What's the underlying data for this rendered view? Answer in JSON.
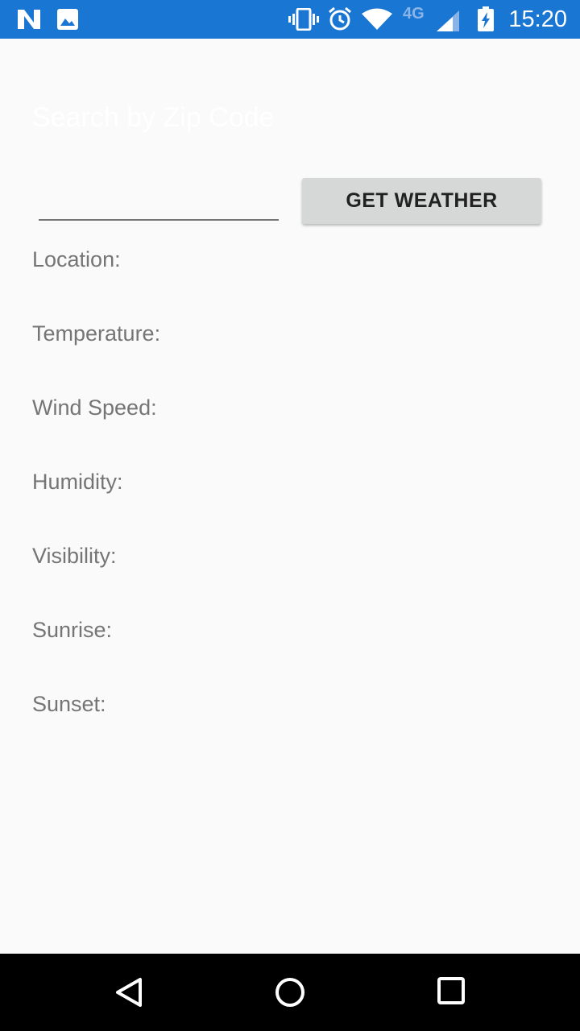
{
  "status_bar": {
    "time": "15:20",
    "network_type": "4G",
    "icons": [
      "app-n-icon",
      "gallery-icon",
      "vibrate-icon",
      "alarm-icon",
      "wifi-icon",
      "cell-signal-icon",
      "battery-charging-icon"
    ]
  },
  "colors": {
    "status_bar": "#1976d2",
    "background": "#fafafa",
    "button": "#d6d7d7",
    "label_text": "#757575"
  },
  "header": {
    "title": "Search by Zip Code"
  },
  "search": {
    "value": "",
    "button_label": "GET WEATHER"
  },
  "info": {
    "location_label": "Location:",
    "temperature_label": "Temperature:",
    "wind_speed_label": "Wind Speed:",
    "humidity_label": "Humidity:",
    "visibility_label": "Visibility:",
    "sunrise_label": "Sunrise:",
    "sunset_label": "Sunset:"
  },
  "nav_bar": {
    "icons": [
      "back-icon",
      "home-icon",
      "recents-icon"
    ]
  }
}
